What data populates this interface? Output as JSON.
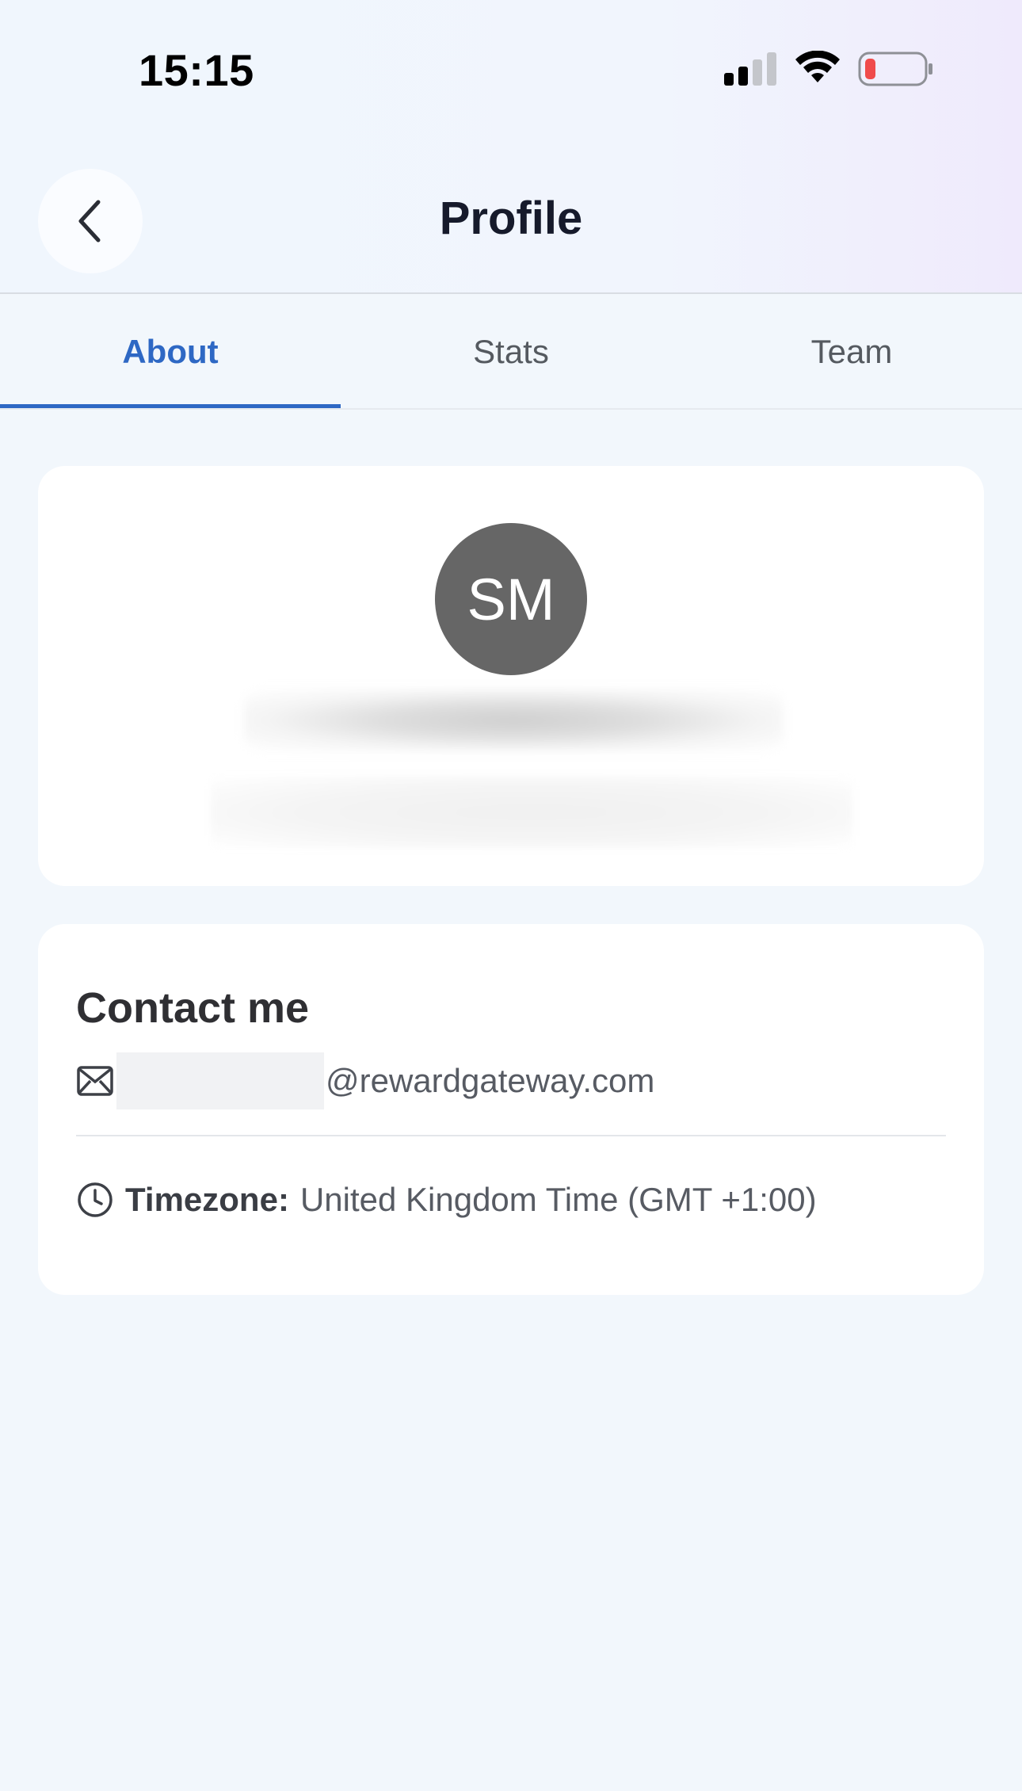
{
  "status_bar": {
    "time": "15:15",
    "battery_color": "#f04b4b"
  },
  "header": {
    "title": "Profile",
    "back_icon": "chevron-left-icon"
  },
  "tabs": [
    {
      "label": "About",
      "active": true
    },
    {
      "label": "Stats",
      "active": false
    },
    {
      "label": "Team",
      "active": false
    }
  ],
  "profile": {
    "initials": "SM",
    "avatar_color": "#666666"
  },
  "contact": {
    "title": "Contact me",
    "email_domain": "@rewardgateway.com",
    "timezone_label": "Timezone:",
    "timezone_value": "United Kingdom Time (GMT +1:00)"
  },
  "colors": {
    "accent": "#2e68c4",
    "background": "#f2f7fc"
  }
}
